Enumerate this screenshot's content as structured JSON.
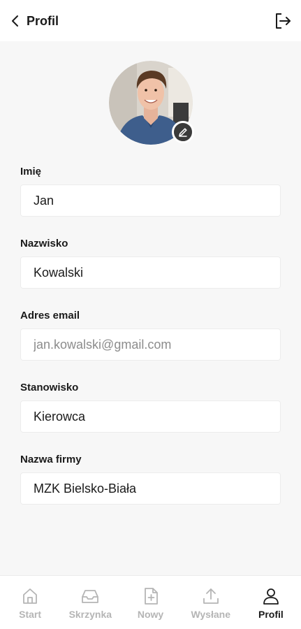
{
  "header": {
    "title": "Profil",
    "back_icon": "chevron-left-icon",
    "logout_icon": "logout-icon"
  },
  "avatar": {
    "edit_icon": "pencil-icon"
  },
  "form": {
    "first_name": {
      "label": "Imię",
      "value": "Jan"
    },
    "last_name": {
      "label": "Nazwisko",
      "value": "Kowalski"
    },
    "email": {
      "label": "Adres email",
      "value": "jan.kowalski@gmail.com"
    },
    "position": {
      "label": "Stanowisko",
      "value": "Kierowca"
    },
    "company": {
      "label": "Nazwa firmy",
      "value": "MZK Bielsko-Biała"
    }
  },
  "nav": {
    "items": [
      {
        "label": "Start",
        "icon": "home-icon"
      },
      {
        "label": "Skrzynka",
        "icon": "inbox-icon"
      },
      {
        "label": "Nowy",
        "icon": "new-document-icon"
      },
      {
        "label": "Wysłane",
        "icon": "upload-icon"
      },
      {
        "label": "Profil",
        "icon": "user-icon",
        "active": true
      }
    ]
  },
  "colors": {
    "background": "#f7f7f7",
    "surface": "#ffffff",
    "text": "#1a1a1a",
    "muted": "#b5b5b5",
    "disabled_text": "#8c8c8c"
  }
}
